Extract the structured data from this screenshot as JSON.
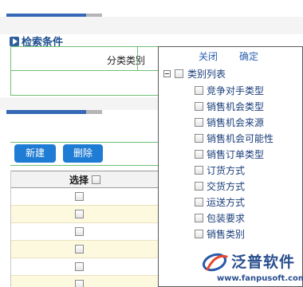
{
  "search": {
    "title": "检索条件",
    "field_label": "分类类别"
  },
  "toolbar": {
    "new_label": "新建",
    "delete_label": "删除"
  },
  "grid": {
    "header_label": "选择",
    "row_count": 6
  },
  "popup": {
    "close_label": "关闭",
    "ok_label": "确定",
    "root_label": "类别列表",
    "items": [
      {
        "label": "竞争对手类型"
      },
      {
        "label": "销售机会类型"
      },
      {
        "label": "销售机会来源"
      },
      {
        "label": "销售机会可能性"
      },
      {
        "label": "销售订单类型"
      },
      {
        "label": "订货方式"
      },
      {
        "label": "交货方式"
      },
      {
        "label": "运送方式"
      },
      {
        "label": "包装要求"
      },
      {
        "label": "销售类别"
      }
    ]
  },
  "watermark": {
    "brand": "泛普软件",
    "url": "www.fanpusoft.com"
  },
  "colors": {
    "accent": "#1f7cd4",
    "link": "#2c60b0",
    "border_green": "#6fbf73",
    "row_alt": "#fdf9df"
  }
}
